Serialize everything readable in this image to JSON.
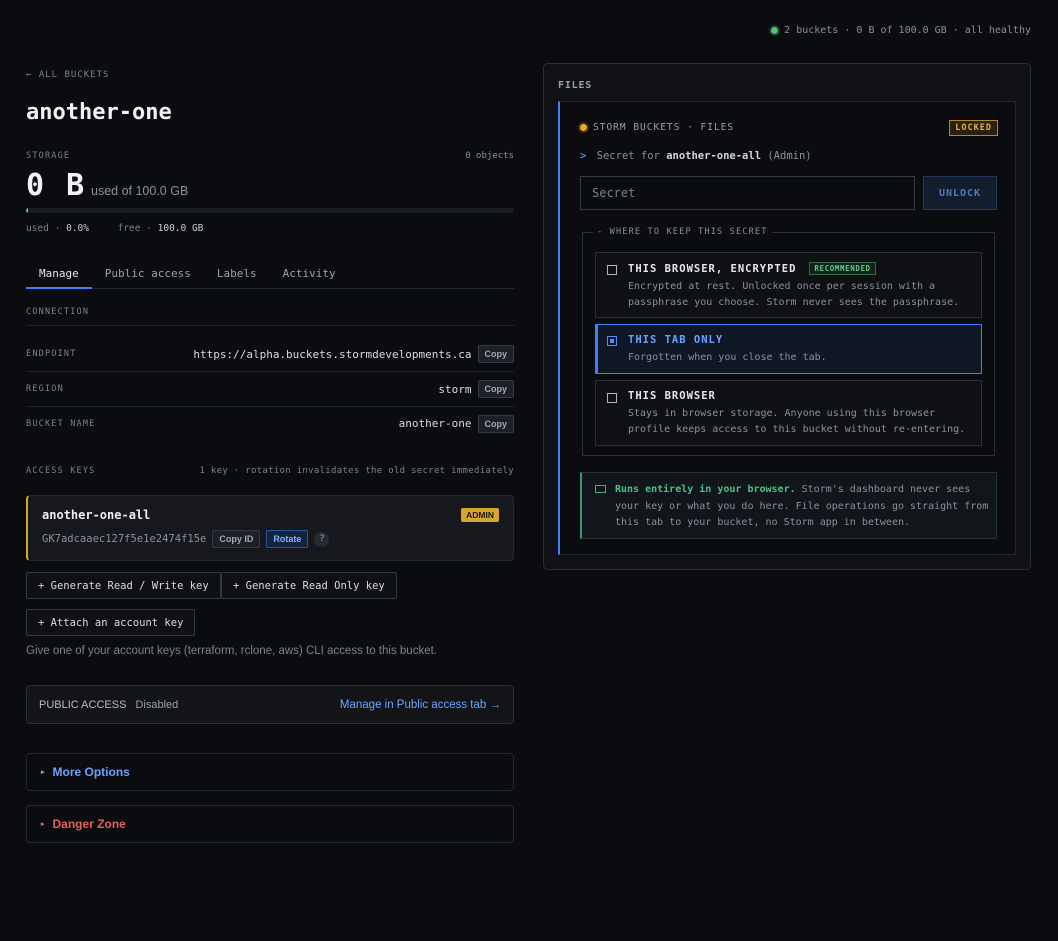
{
  "status": {
    "text": "2 buckets · 0 B of 100.0 GB · all healthy",
    "color": "#4ec27a"
  },
  "nav": {
    "back": "← ALL BUCKETS"
  },
  "bucket": {
    "name": "another-one",
    "storage_label": "STORAGE",
    "objects": "0 objects",
    "used_big": "0 B",
    "used_of": "used of 100.0 GB",
    "used_fraction": 0.0,
    "used_label": "used ·",
    "used_pct": "0.0%",
    "free_label": "free ·",
    "free_val": "100.0 GB"
  },
  "tabs": [
    "Manage",
    "Public access",
    "Labels",
    "Activity"
  ],
  "connection": {
    "title": "CONNECTION",
    "rows": [
      {
        "label": "ENDPOINT",
        "value": "https://alpha.buckets.stormdevelopments.ca",
        "button": "Copy"
      },
      {
        "label": "REGION",
        "value": "storm",
        "button": "Copy"
      },
      {
        "label": "BUCKET NAME",
        "value": "another-one",
        "button": "Copy"
      }
    ]
  },
  "access_keys": {
    "title": "ACCESS KEYS",
    "note": "1 key · rotation invalidates the old secret immediately",
    "key": {
      "name": "another-one-all",
      "badge": "ADMIN",
      "id": "GK7adcaaec127f5e1e2474f15e",
      "copy_id": "Copy ID",
      "rotate": "Rotate",
      "help": "?"
    },
    "buttons": [
      "+ Generate Read / Write key",
      "+ Generate Read Only key",
      "+ Attach an account key"
    ],
    "hint": "Give one of your account keys (terraform, rclone, aws) CLI access to this bucket."
  },
  "public_access": {
    "label": "PUBLIC ACCESS",
    "state": "Disabled",
    "link": "Manage in Public access tab →"
  },
  "more_options": {
    "label": "More Options",
    "color": "#6aa3ff"
  },
  "danger_zone": {
    "label": "Danger Zone",
    "color": "#e5605a"
  },
  "files": {
    "label": "FILES",
    "header": "STORM BUCKETS · FILES",
    "locked": "LOCKED",
    "secret_prefix": ">",
    "secret_for_pre": "Secret for",
    "secret_for_key": "another-one-all",
    "secret_for_post": "(Admin)",
    "placeholder": "Secret",
    "unlock": "UNLOCK",
    "legend": "- WHERE TO KEEP THIS SECRET",
    "options": [
      {
        "title": "THIS BROWSER, ENCRYPTED",
        "badge": "RECOMMENDED",
        "desc": "Encrypted at rest. Unlocked once per session with a passphrase you choose. Storm never sees the passphrase.",
        "selected": false
      },
      {
        "title": "THIS TAB ONLY",
        "desc": "Forgotten when you close the tab.",
        "selected": true
      },
      {
        "title": "THIS BROWSER",
        "desc": "Stays in browser storage. Anyone using this browser profile keeps access to this bucket without re-entering.",
        "selected": false
      }
    ],
    "info_bold": "Runs entirely in your browser.",
    "info_rest": " Storm's dashboard never sees your key or what you do here. File operations go straight from this tab to your bucket, no Storm app in between."
  }
}
